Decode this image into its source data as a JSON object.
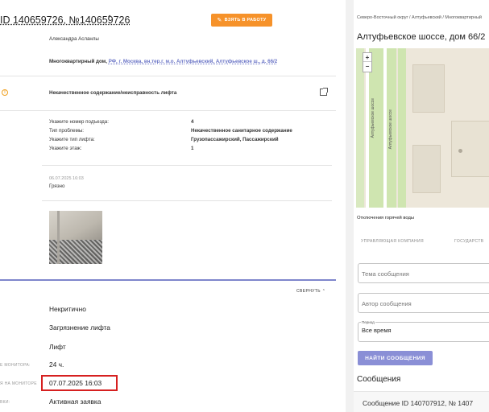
{
  "ticket": {
    "title": "ID 140659726, №140659726",
    "take_button": "ВЗЯТЬ В РАБОТУ",
    "author": "Александра Асланлы",
    "building_type": "Многоквартирный дом,",
    "building_address": "РФ, г. Москва, вн.тер.г. м.о. Алтуфьевский, Алтуфьевское ш., д. 66/2",
    "problem_title": "Некачественное содержание/неисправность лифта",
    "fields": [
      {
        "label": "Укажите номер подъезда:",
        "value": "4"
      },
      {
        "label": "Тип проблемы:",
        "value": "Некачественное санитарное содержание"
      },
      {
        "label": "Укажите тип лифта:",
        "value": "Грузопассажирский, Пассажирский"
      },
      {
        "label": "Укажите этаж:",
        "value": "1"
      }
    ],
    "comment_date": "06.07.2025 16:03",
    "comment_text": "Грязно",
    "collapse_label": "СВЕРНУТЬ"
  },
  "details": [
    {
      "label": "",
      "value": "Некритично"
    },
    {
      "label": "",
      "value": "Загрязнение лифта"
    },
    {
      "label": "",
      "value": "Лифт"
    },
    {
      "label": "Е МОНИТОРА:",
      "value": "24 ч."
    },
    {
      "label": "Я НА МОНИТОРЕ",
      "value": "07.07.2025 16:03"
    },
    {
      "label": "ВКИ:",
      "value": "Активная заявка"
    }
  ],
  "right": {
    "breadcrumb": "Северо-Восточный округ / Алтуфьевский / Многоквартирный",
    "address_title": "Алтуфьевское шоссе, дом 66/2",
    "map_road_labels": [
      "Алтуфьевское шоссе",
      "Алтуфьевское шоссе"
    ],
    "outage": "Отключения горячей воды",
    "tabs": [
      "УПРАВЛЯЮЩАЯ КОМПАНИЯ",
      "ГОСУДАРСТВ"
    ],
    "topic_placeholder": "Тема сообщения",
    "author_placeholder": "Автор сообщения",
    "period_label": "Период",
    "period_value": "Все время",
    "find_button": "НАЙТИ СООБЩЕНИЯ",
    "messages_title": "Сообщения",
    "message_row": "Сообщение ID 140707912, № 1407"
  },
  "colors": {
    "accent": "#7e86cc",
    "orange": "#f6922a",
    "highlight": "#d62020"
  }
}
